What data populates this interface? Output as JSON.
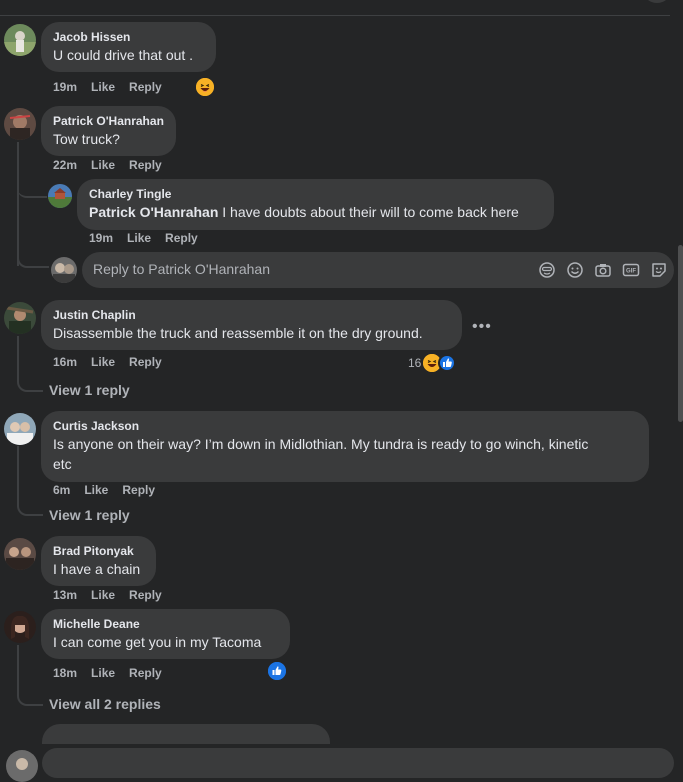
{
  "comments": [
    {
      "author": "Jacob Hissen",
      "text": "U could drive that out .",
      "time": "19m",
      "like": "Like",
      "reply": "Reply"
    },
    {
      "author": "Patrick O'Hanrahan",
      "text": "Tow truck?",
      "time": "22m",
      "like": "Like",
      "reply": "Reply",
      "replies": [
        {
          "author": "Charley Tingle",
          "mention": "Patrick O'Hanrahan",
          "text": " I have doubts about their will to come back here",
          "time": "19m",
          "like": "Like",
          "reply": "Reply"
        }
      ]
    },
    {
      "author": "Justin Chaplin",
      "text": "Disassemble the truck and reassemble it on the dry ground.",
      "time": "16m",
      "like": "Like",
      "reply": "Reply",
      "reaction_count": "16",
      "view_replies": "View 1 reply"
    },
    {
      "author": "Curtis Jackson",
      "text_line1": "Is anyone on their way? I’m down in Midlothian. My tundra is ready to go winch, kinetic",
      "text_line2": "etc",
      "time": "6m",
      "like": "Like",
      "reply": "Reply",
      "view_replies": "View 1 reply"
    },
    {
      "author": "Brad Pitonyak",
      "text": "I have a chain",
      "time": "13m",
      "like": "Like",
      "reply": "Reply"
    },
    {
      "author": "Michelle Deane",
      "text": "I can come get you in my Tacoma",
      "time": "18m",
      "like": "Like",
      "reply": "Reply",
      "view_replies": "View all 2 replies"
    }
  ],
  "reply_box": {
    "placeholder": "Reply to Patrick O'Hanrahan"
  },
  "icons": {
    "avatar_emoji": "avatar-emoji-icon",
    "emoji": "smiley-icon",
    "camera": "camera-icon",
    "gif": "gif-icon",
    "sticker": "sticker-icon",
    "more": "more-options-icon"
  },
  "colors": {
    "background": "#242526",
    "bubble": "#3a3b3c",
    "secondary_text": "#b0b3b8",
    "like_blue": "#1b74e4",
    "haha_yellow": "#f7b125"
  }
}
